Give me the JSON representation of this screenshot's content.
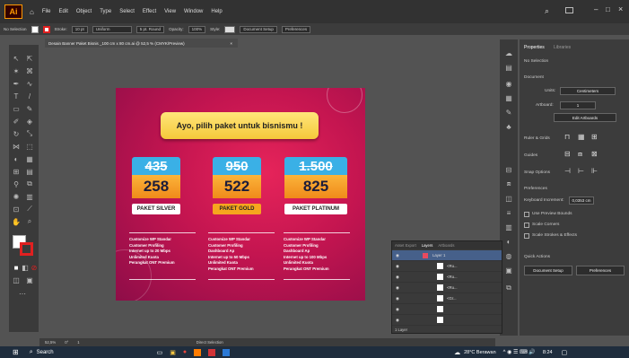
{
  "menubar": {
    "app_logo": "Ai",
    "items": [
      "File",
      "Edit",
      "Object",
      "Type",
      "Select",
      "Effect",
      "View",
      "Window",
      "Help"
    ],
    "window_controls": [
      "–",
      "□",
      "×"
    ]
  },
  "control_bar": {
    "selection": "No Selection",
    "stroke_label": "Stroke:",
    "stroke_value": "10 pt",
    "uniform": "Uniform",
    "brush": "5 pt. Round",
    "opacity_label": "Opacity:",
    "opacity_value": "100%",
    "style_label": "Style:",
    "doc_setup": "Document Setup",
    "preferences": "Preferences"
  },
  "document_tab": {
    "title": "Desain Banner Paket Bisnis _100 cm x 80 cm.ai @ 52,5 % (CMYK/Preview)",
    "close": "×"
  },
  "banner": {
    "headline": "Ayo, pilih paket untuk bisnismu !",
    "cards": [
      {
        "old_price": "435",
        "new_price": "258",
        "name": "PAKET SILVER"
      },
      {
        "old_price": "950",
        "new_price": "522",
        "name": "PAKET GOLD"
      },
      {
        "old_price": "1.500",
        "new_price": "825",
        "name": "PAKET PLATINUM"
      }
    ],
    "features": [
      [
        "Customize WP Standar",
        "Customer Profiling",
        "Internet up to 20 Mbps",
        "Unlimited Kuota",
        "Perangkat ONT Premium"
      ],
      [
        "Customize WP Standar",
        "Customer Profiling",
        "Dashboard Ap",
        "Internet up to 50 Mbps",
        "Unlimited Kuota",
        "Perangkat ONT Premium"
      ],
      [
        "Customize WP Standar",
        "Customer Profiling",
        "Dashboard Ap",
        "Internet up to 100 Mbps",
        "Unlimited Kuota",
        "Perangkat ONT Premium"
      ]
    ]
  },
  "properties": {
    "tab_properties": "Properties",
    "tab_libraries": "Libraries",
    "no_selection": "No Selection",
    "document": "Document",
    "units_label": "Units:",
    "units_value": "Centimeters",
    "artboard_label": "Artboard:",
    "artboard_value": "1",
    "edit_artboards": "Edit Artboards",
    "rulers_grids": "Ruler & Grids",
    "guides": "Guides",
    "snap_options": "Snap Options",
    "preferences": "Preferences",
    "keyboard_increment": "Keyboard Increment:",
    "keyboard_value": "0,0353 cm",
    "use_preview_bounds": "Use Preview Bounds",
    "scale_corners": "Scale Corners",
    "scale_strokes": "Scale Strokes & Effects",
    "quick_actions": "Quick Actions",
    "doc_setup_btn": "Document Setup",
    "prefs_btn": "Preferences"
  },
  "layers": {
    "tabs": [
      "Asset Export",
      "Layers",
      "Artboards"
    ],
    "layer_name": "Layer 1",
    "rows": [
      "<Ru...",
      "<Ru...",
      "<Ru...",
      "<Gr...",
      "",
      ""
    ],
    "footer": "1 Layer"
  },
  "status": {
    "zoom": "52,5%",
    "angle": "0°",
    "artboard": "1",
    "tool": "Direct Selection"
  },
  "taskbar": {
    "search": "Search",
    "weather": "28°C Berawan",
    "time": "8:24"
  }
}
